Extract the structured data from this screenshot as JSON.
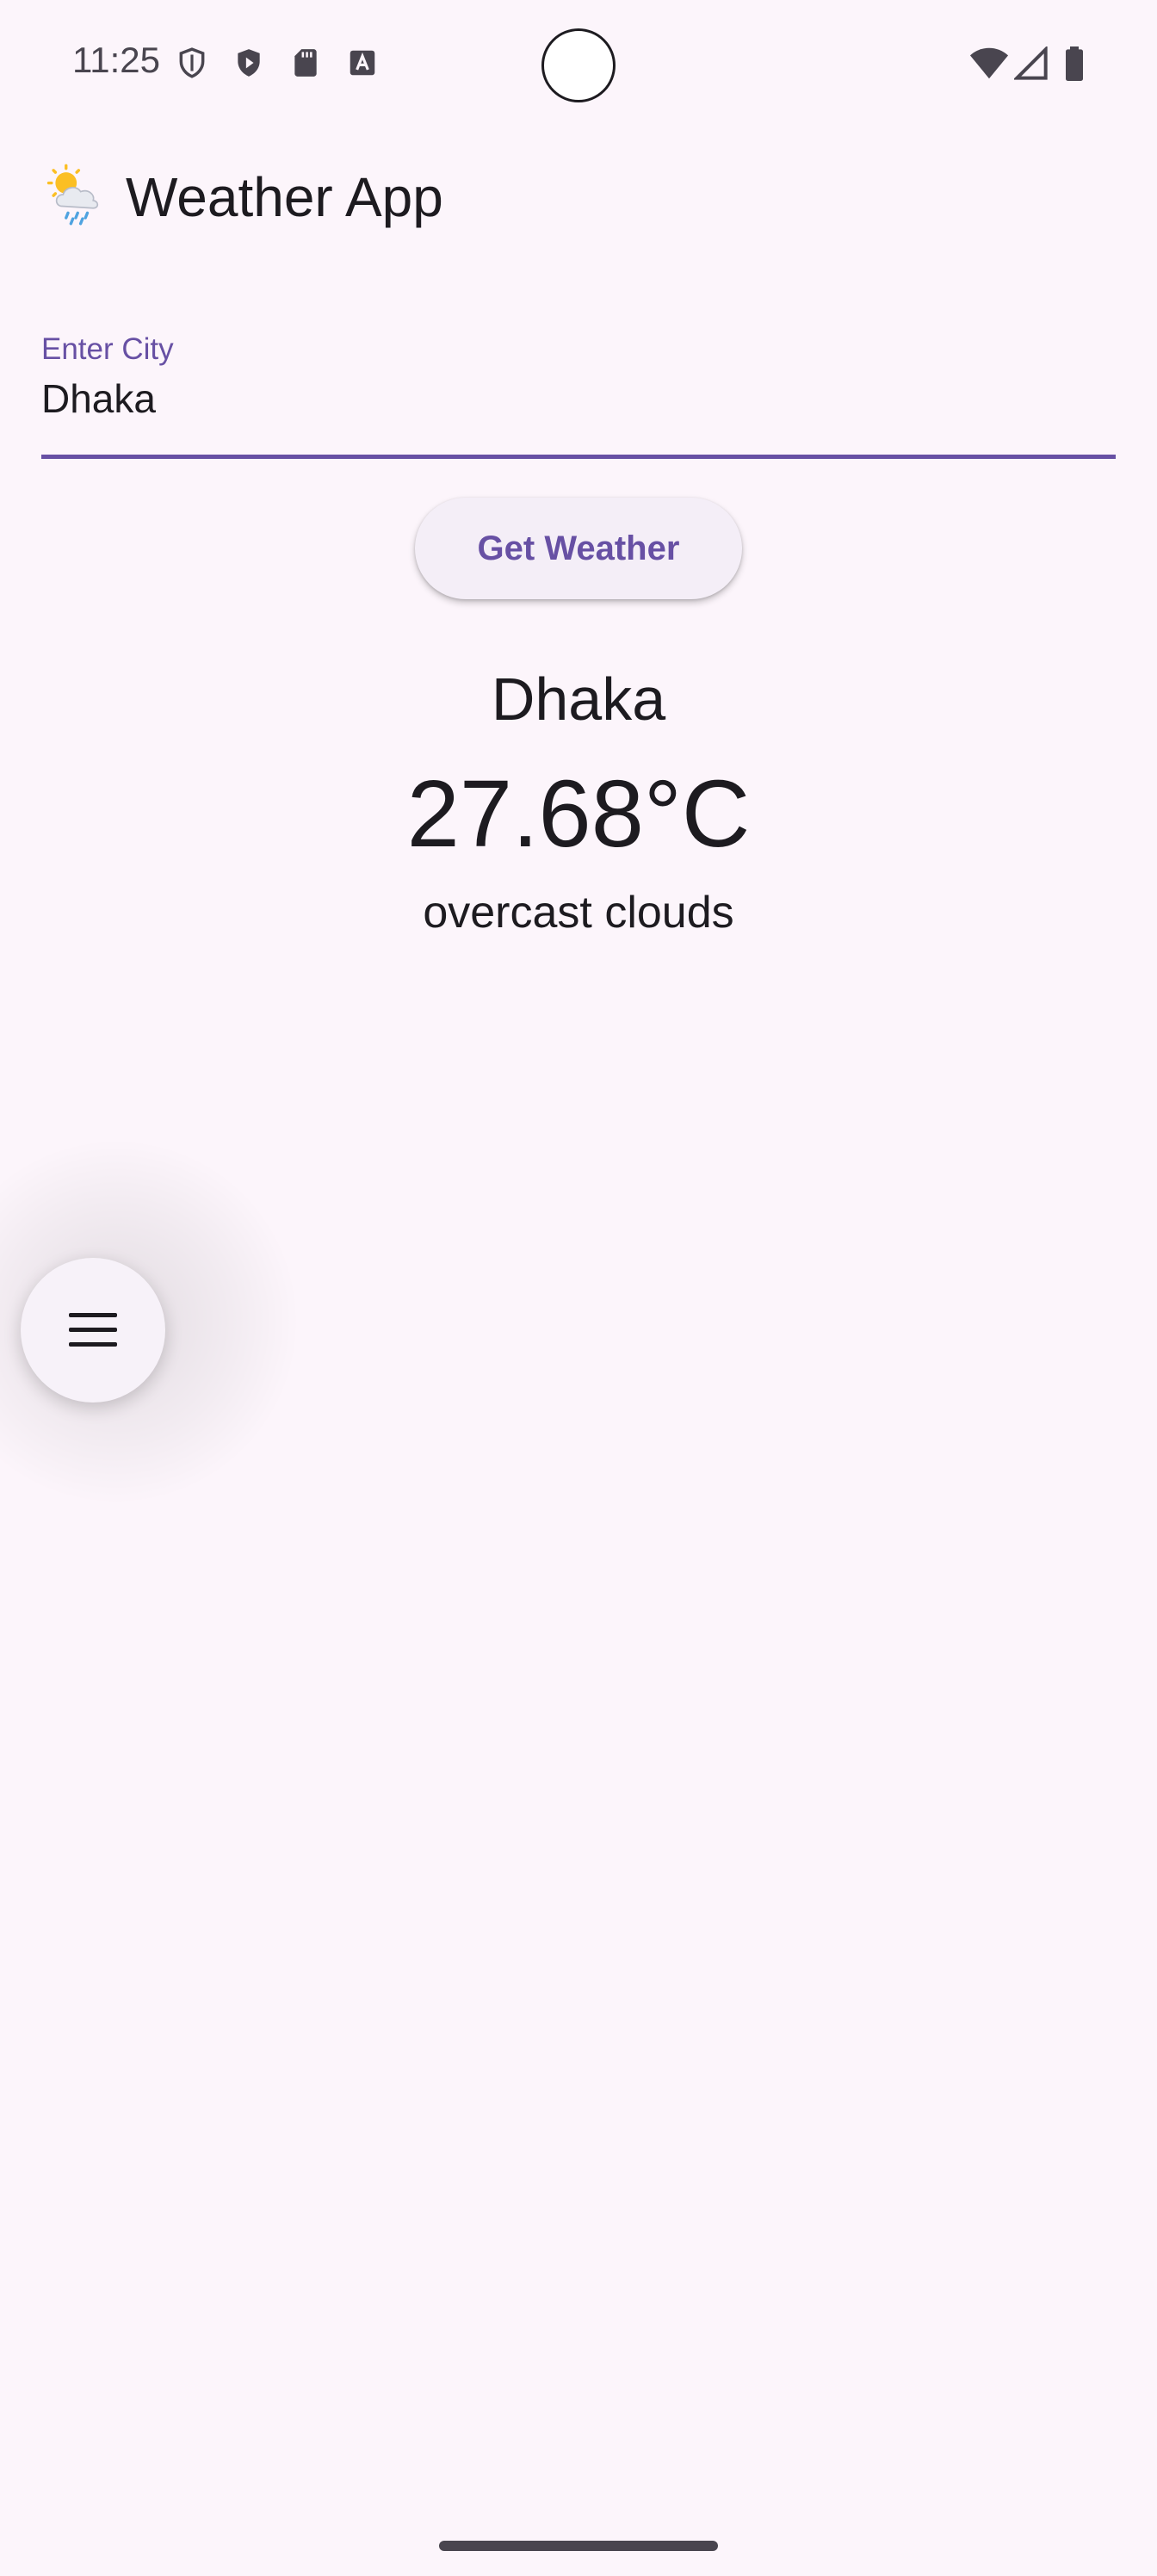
{
  "status_bar": {
    "time": "11:25",
    "left_icons": [
      "shield-outline-icon",
      "shield-play-icon",
      "sd-card-icon",
      "font-a-icon"
    ],
    "right_icons": [
      "wifi-icon",
      "cell-signal-icon",
      "battery-icon"
    ]
  },
  "app_bar": {
    "logo_icon": "sun-behind-rain-cloud-icon",
    "title": "Weather App"
  },
  "search": {
    "label": "Enter City",
    "value": "Dhaka"
  },
  "actions": {
    "get_weather_label": "Get Weather"
  },
  "weather": {
    "city": "Dhaka",
    "temperature": "27.68°C",
    "description": "overcast clouds"
  },
  "floating_menu": {
    "icon": "hamburger-menu-icon"
  },
  "colors": {
    "background": "#fcf5fb",
    "accent": "#6750a4",
    "text_primary": "#1d1b20",
    "text_secondary": "#49454f",
    "button_surface": "#f4eef7"
  }
}
